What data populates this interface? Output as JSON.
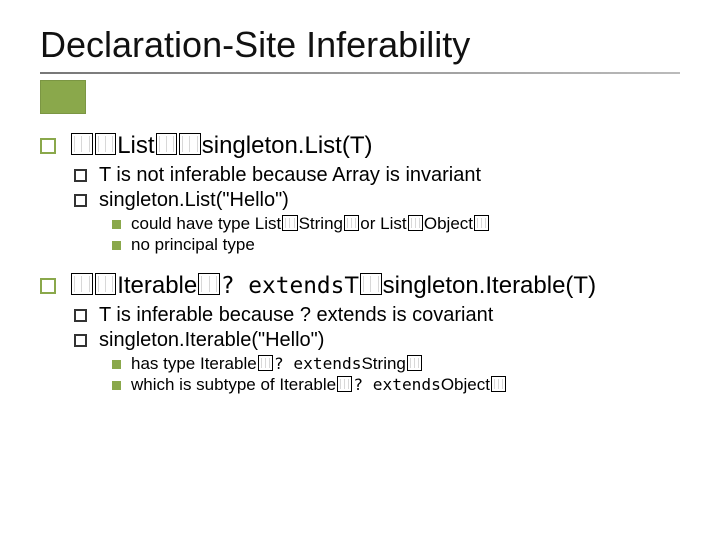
{
  "slide": {
    "title": "Declaration-Site Inferability",
    "bullets": [
      {
        "parts": [
          "",
          "List",
          "",
          "singleton.List(T)"
        ],
        "tofu_pairs_before": [
          2,
          2,
          0,
          0
        ],
        "children": [
          {
            "text": "T is not inferable because Array is invariant",
            "children": []
          },
          {
            "text": "singleton.List(\"Hello\")",
            "children": [
              {
                "parts": [
                  "could have type List",
                  "String",
                  "or List",
                  "Object",
                  ""
                ],
                "tofu_after": [
                  1,
                  1,
                  0,
                  1,
                  1
                ]
              },
              {
                "text": "no principal type"
              }
            ]
          }
        ]
      },
      {
        "parts": [
          "",
          "Iterable",
          "",
          "T",
          "singleton.Iterable(T)"
        ],
        "tofu_pairs_before": [
          2,
          1,
          0,
          1,
          0
        ],
        "extends_after_index": 1,
        "children": [
          {
            "text": "T is inferable because ? extends is covariant",
            "children": []
          },
          {
            "text": "singleton.Iterable(\"Hello\")",
            "children": [
              {
                "parts": [
                  "has type Iterable",
                  "String",
                  ""
                ],
                "tofu_after": [
                  1,
                  0,
                  1
                ],
                "extends_after_index": 0
              },
              {
                "parts": [
                  "which is subtype of Iterable",
                  "Object",
                  ""
                ],
                "tofu_after": [
                  1,
                  0,
                  1
                ],
                "extends_after_index": 0
              }
            ]
          }
        ]
      }
    ],
    "extends_label": "? extends"
  }
}
